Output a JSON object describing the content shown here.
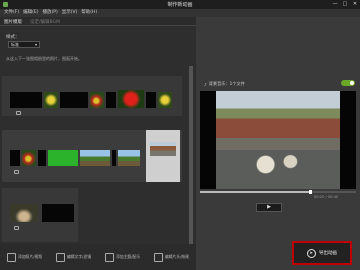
{
  "window": {
    "title": "制作新动画",
    "controls": [
      "—",
      "□",
      "✕"
    ]
  },
  "menu": [
    "文件(F)",
    "编辑(E)",
    "播放(P)",
    "显示(V)",
    "帮助(H)"
  ],
  "tabs": [
    {
      "label": "图片模版",
      "active": true
    },
    {
      "label": "设定/编辑BGM",
      "active": false
    }
  ],
  "style": {
    "label": "样式：",
    "value": "标准"
  },
  "hint": "从这入下一张图相册里的照片，图面开始。",
  "music": {
    "label": "背景音乐：1个文件",
    "enabled": true
  },
  "player": {
    "time": "00:20 / 00:40",
    "play_icon": "▶"
  },
  "toolbar": [
    {
      "label": "添加照片/视频",
      "icon": "add-photo-icon"
    },
    {
      "label": "编辑文字/滤镜",
      "icon": "edit-text-icon"
    },
    {
      "label": "添加主题/配乐",
      "icon": "add-theme-icon"
    },
    {
      "label": "编辑片头/结尾",
      "icon": "edit-title-icon"
    }
  ],
  "export": {
    "label": "导出动画",
    "icon": "export-icon"
  },
  "colors": {
    "accent": "#6aa82a",
    "highlight": "#c00000",
    "background": "#2b2b2b"
  }
}
